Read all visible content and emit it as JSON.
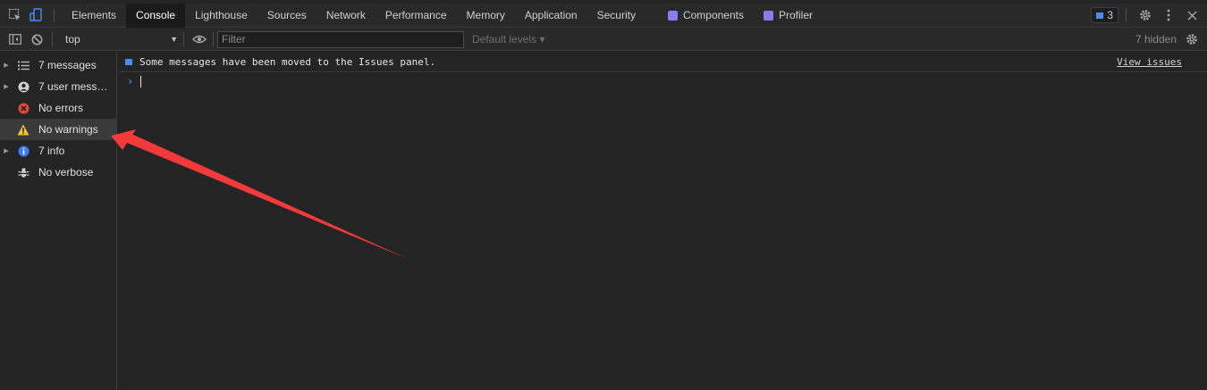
{
  "tabs": [
    {
      "label": "Elements",
      "active": false,
      "ext": false
    },
    {
      "label": "Console",
      "active": true,
      "ext": false
    },
    {
      "label": "Lighthouse",
      "active": false,
      "ext": false
    },
    {
      "label": "Sources",
      "active": false,
      "ext": false
    },
    {
      "label": "Network",
      "active": false,
      "ext": false
    },
    {
      "label": "Performance",
      "active": false,
      "ext": false
    },
    {
      "label": "Memory",
      "active": false,
      "ext": false
    },
    {
      "label": "Application",
      "active": false,
      "ext": false
    },
    {
      "label": "Security",
      "active": false,
      "ext": false
    },
    {
      "label": "Components",
      "active": false,
      "ext": true
    },
    {
      "label": "Profiler",
      "active": false,
      "ext": true
    }
  ],
  "issues_count": "3",
  "toolbar": {
    "context": "top",
    "filter_placeholder": "Filter",
    "levels": "Default levels ▾",
    "hidden": "7 hidden"
  },
  "sidebar": {
    "items": [
      {
        "label": "7 messages",
        "icon": "list-icon",
        "expandable": true
      },
      {
        "label": "7 user messa...",
        "icon": "user-icon",
        "expandable": true
      },
      {
        "label": "No errors",
        "icon": "error-icon",
        "expandable": false
      },
      {
        "label": "No warnings",
        "icon": "warning-icon",
        "expandable": false,
        "selected": true
      },
      {
        "label": "7 info",
        "icon": "info-icon",
        "expandable": true
      },
      {
        "label": "No verbose",
        "icon": "bug-icon",
        "expandable": false
      }
    ]
  },
  "console": {
    "message": "Some messages have been moved to the Issues panel.",
    "link": "View issues",
    "prompt": "›"
  },
  "colors": {
    "accent_blue": "#4a8bf5",
    "arrow_red": "#f23a3a",
    "error_red": "#e8443a",
    "warning_yellow": "#f2c230",
    "info_blue": "#3d7cf0"
  }
}
